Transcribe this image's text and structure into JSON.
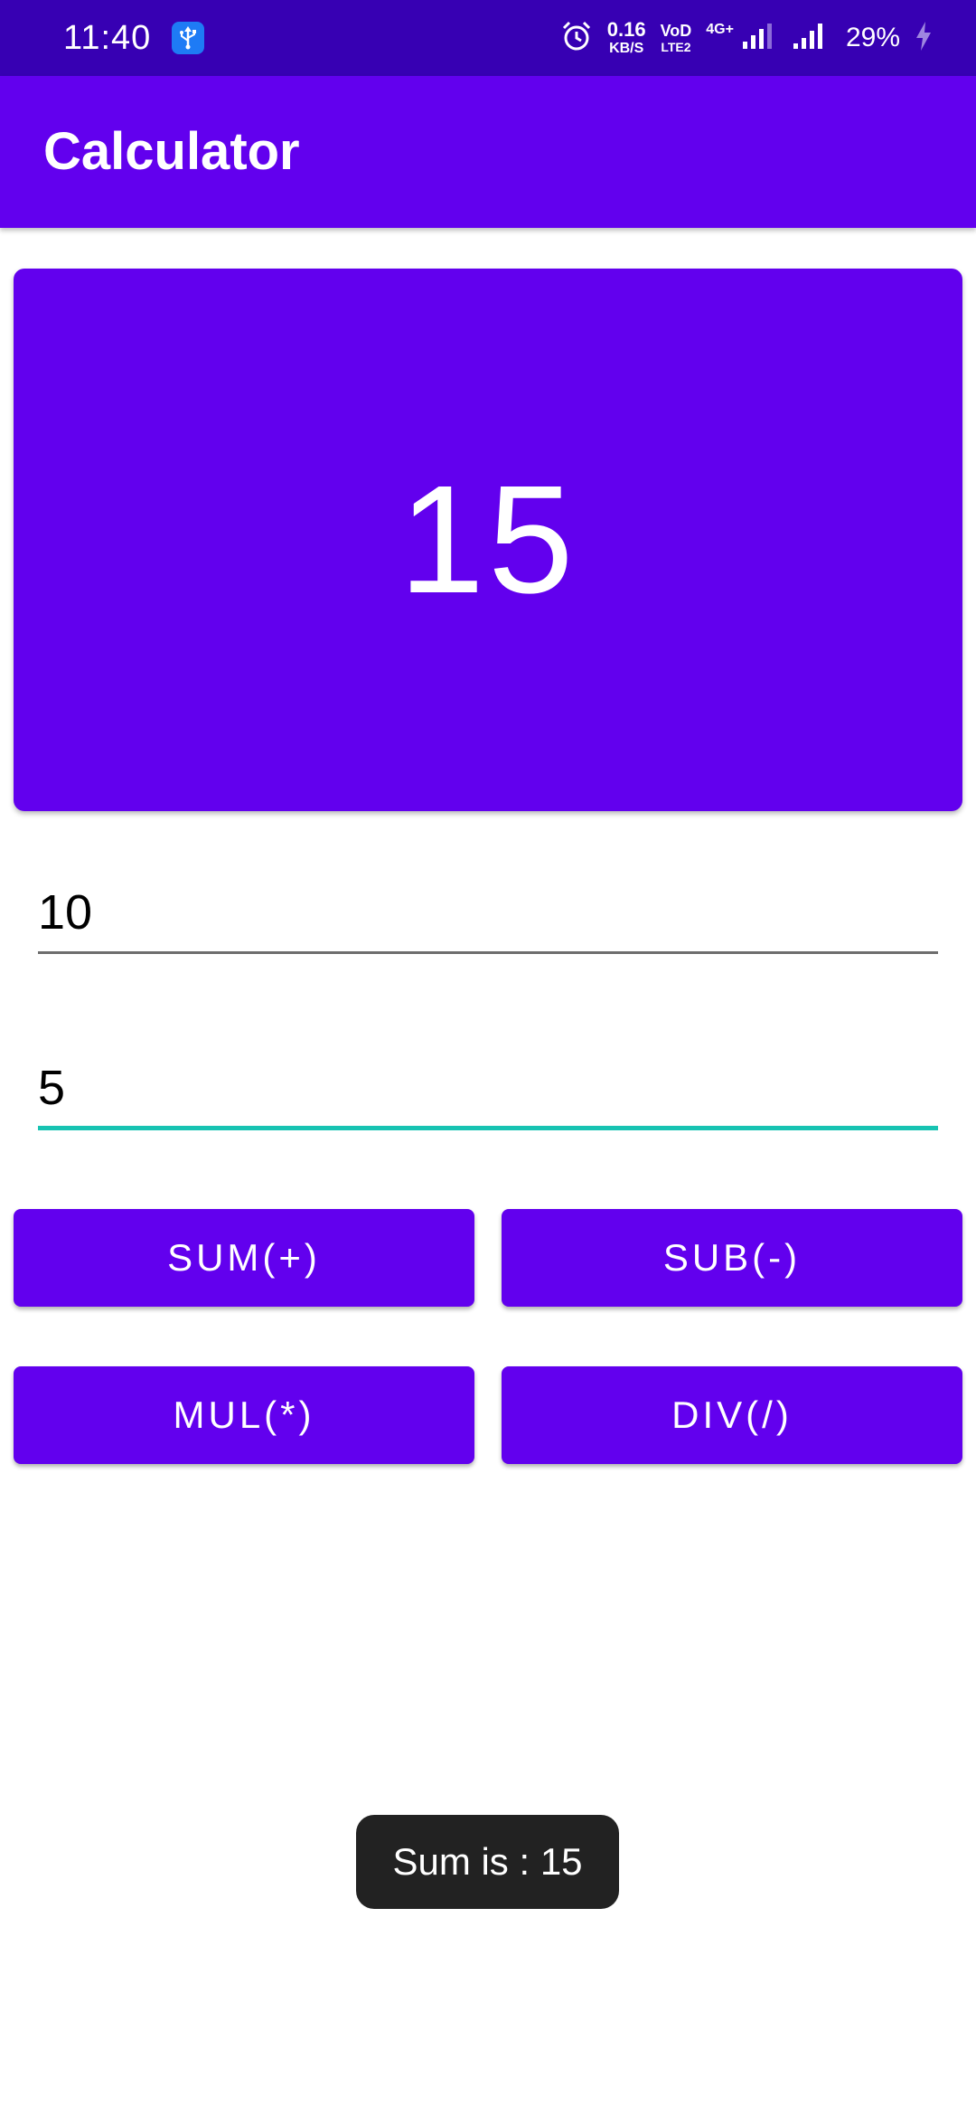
{
  "status_bar": {
    "time": "11:40",
    "usb_icon": "usb-icon",
    "net_speed_value": "0.16",
    "net_speed_unit": "KB/S",
    "volte_top": "VoD",
    "volte_bottom": "LTE2",
    "network_type": "4G+",
    "battery_percent": "29%"
  },
  "app_bar": {
    "title": "Calculator"
  },
  "result": {
    "value": "15"
  },
  "inputs": {
    "first": "10",
    "second": "5"
  },
  "buttons": {
    "sum": "SUM(+)",
    "sub": "SUB(-)",
    "mul": "MUL(*)",
    "div": "DIV(/)"
  },
  "toast": {
    "message": "Sum is : 15"
  },
  "colors": {
    "status_bar": "#3700b3",
    "primary": "#6200ee",
    "focused_underline": "#17c3b2",
    "toast_bg": "#222222"
  }
}
